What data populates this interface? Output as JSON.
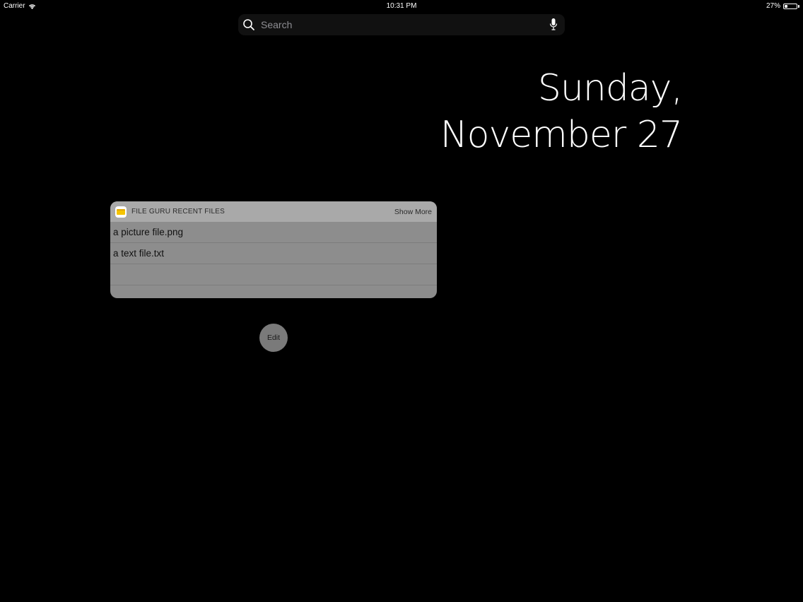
{
  "status_bar": {
    "carrier": "Carrier",
    "time": "10:31 PM",
    "battery_percent": "27%",
    "battery_level": 0.27,
    "wifi_icon": "wifi-icon",
    "battery_icon": "battery-icon"
  },
  "search": {
    "placeholder": "Search",
    "search_icon": "search-icon",
    "mic_icon": "microphone-icon"
  },
  "date": {
    "line1": "Sunday,",
    "line2": "November 27"
  },
  "widget": {
    "title": "FILE GURU RECENT FILES",
    "show_more_label": "Show More",
    "app_icon": "file-guru-app-icon",
    "files": [
      {
        "name": "a picture file.png"
      },
      {
        "name": "a text file.txt"
      },
      {
        "name": ""
      },
      {
        "name": ""
      }
    ]
  },
  "edit_button": {
    "label": "Edit"
  },
  "colors": {
    "background": "#000000",
    "widget_header": "#a9a9a9",
    "widget_body": "#8d8d8d",
    "edit_button": "#7a7a7a"
  }
}
